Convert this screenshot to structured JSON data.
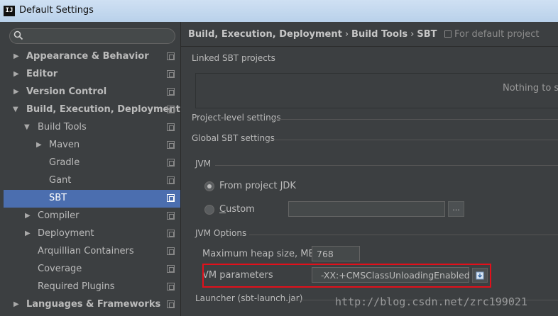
{
  "window": {
    "title": "Default Settings",
    "app_icon_text": "IJ"
  },
  "search": {
    "placeholder": ""
  },
  "sidebar": {
    "items": [
      {
        "label": "Appearance & Behavior",
        "arrow": "▶"
      },
      {
        "label": "Editor",
        "arrow": "▶"
      },
      {
        "label": "Version Control",
        "arrow": "▶"
      },
      {
        "label": "Build, Execution, Deployment",
        "arrow": "▼"
      },
      {
        "label": "Build Tools",
        "arrow": "▼"
      },
      {
        "label": "Maven",
        "arrow": "▶"
      },
      {
        "label": "Gradle",
        "arrow": ""
      },
      {
        "label": "Gant",
        "arrow": ""
      },
      {
        "label": "SBT",
        "arrow": ""
      },
      {
        "label": "Compiler",
        "arrow": "▶"
      },
      {
        "label": "Deployment",
        "arrow": "▶"
      },
      {
        "label": "Arquillian Containers",
        "arrow": ""
      },
      {
        "label": "Coverage",
        "arrow": ""
      },
      {
        "label": "Required Plugins",
        "arrow": ""
      },
      {
        "label": "Languages & Frameworks",
        "arrow": "▶"
      }
    ]
  },
  "breadcrumb": {
    "part1": "Build, Execution, Deployment",
    "sep": "›",
    "part2": "Build Tools",
    "part3": "SBT",
    "subtitle": "For default project"
  },
  "sections": {
    "linked": "Linked SBT projects",
    "linked_empty": "Nothing to sh",
    "project_level": "Project-level settings",
    "global": "Global SBT settings",
    "jvm": "JVM",
    "jvm_options": "JVM Options",
    "launcher": "Launcher (sbt-launch.jar)"
  },
  "jvm": {
    "from_project_jdk": "From project JDK",
    "custom_prefix": "C",
    "custom_rest": "ustom",
    "browse": "..."
  },
  "options": {
    "heap_label": "Maximum heap size, MB",
    "heap_value": "768",
    "vm_label": "VM parameters",
    "vm_value": "-XX:+CMSClassUnloadingEnabled",
    "expand_icon": "expand-icon"
  },
  "watermark": "http://blog.csdn.net/zrc199021",
  "colors": {
    "selection": "#4b6eaf",
    "highlight_box": "#e2101b"
  }
}
